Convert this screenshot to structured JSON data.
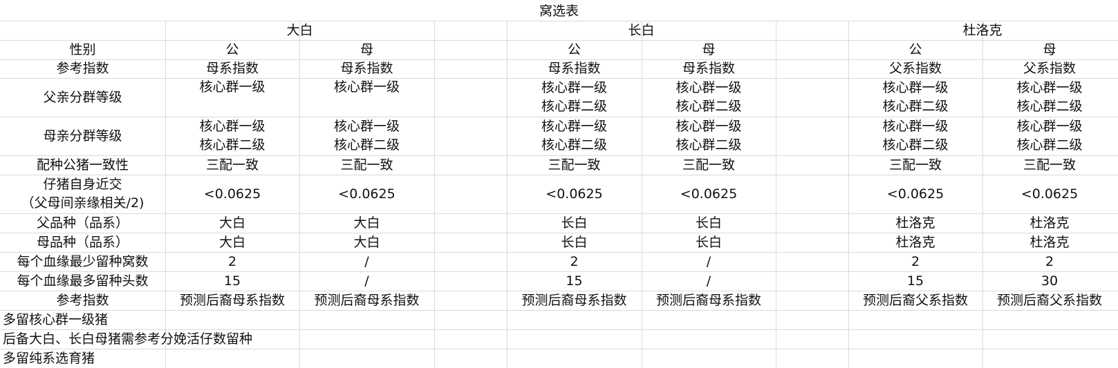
{
  "sheet": {
    "title": "窝选表",
    "breeds": [
      "大白",
      "长白",
      "杜洛克"
    ],
    "row_labels": {
      "sex": "性别",
      "ref_index": "参考指数",
      "father_grade": "父亲分群等级",
      "mother_grade": "母亲分群等级",
      "boar_consistency": "配种公猪一致性",
      "inbreeding_line1": "仔猪自身近交",
      "inbreeding_line2": "（父母间亲缘相关/2)",
      "father_breed": "父品种（品系）",
      "mother_breed": "母品种（品系）",
      "min_litters": "每个血缘最少留种窝数",
      "max_heads": "每个血缘最多留种头数",
      "ref_index2": "参考指数"
    },
    "columns": [
      {
        "sex": "公",
        "ref_index": "母系指数",
        "father_grade": [
          "核心群一级"
        ],
        "mother_grade": [
          "核心群一级",
          "核心群二级"
        ],
        "boar_consistency": "三配一致",
        "inbreeding": "<0.0625",
        "father_breed": "大白",
        "mother_breed": "大白",
        "min_litters": "2",
        "max_heads": "15",
        "ref_index2": "预测后裔母系指数"
      },
      {
        "sex": "母",
        "ref_index": "母系指数",
        "father_grade": [
          "核心群一级"
        ],
        "mother_grade": [
          "核心群一级",
          "核心群二级"
        ],
        "boar_consistency": "三配一致",
        "inbreeding": "<0.0625",
        "father_breed": "大白",
        "mother_breed": "大白",
        "min_litters": "/",
        "max_heads": "/",
        "ref_index2": "预测后裔母系指数"
      },
      {
        "sex": "公",
        "ref_index": "母系指数",
        "father_grade": [
          "核心群一级",
          "核心群二级"
        ],
        "mother_grade": [
          "核心群一级",
          "核心群二级"
        ],
        "boar_consistency": "三配一致",
        "inbreeding": "<0.0625",
        "father_breed": "长白",
        "mother_breed": "长白",
        "min_litters": "2",
        "max_heads": "15",
        "ref_index2": "预测后裔母系指数"
      },
      {
        "sex": "母",
        "ref_index": "母系指数",
        "father_grade": [
          "核心群一级",
          "核心群二级"
        ],
        "mother_grade": [
          "核心群一级",
          "核心群二级"
        ],
        "boar_consistency": "三配一致",
        "inbreeding": "<0.0625",
        "father_breed": "长白",
        "mother_breed": "长白",
        "min_litters": "/",
        "max_heads": "/",
        "ref_index2": "预测后裔母系指数"
      },
      {
        "sex": "公",
        "ref_index": "父系指数",
        "father_grade": [
          "核心群一级",
          "核心群二级"
        ],
        "mother_grade": [
          "核心群一级",
          "核心群二级"
        ],
        "boar_consistency": "三配一致",
        "inbreeding": "<0.0625",
        "father_breed": "杜洛克",
        "mother_breed": "杜洛克",
        "min_litters": "2",
        "max_heads": "15",
        "ref_index2": "预测后裔父系指数"
      },
      {
        "sex": "母",
        "ref_index": "父系指数",
        "father_grade": [
          "核心群一级",
          "核心群二级"
        ],
        "mother_grade": [
          "核心群一级",
          "核心群二级"
        ],
        "boar_consistency": "三配一致",
        "inbreeding": "<0.0625",
        "father_breed": "杜洛克",
        "mother_breed": "杜洛克",
        "min_litters": "2",
        "max_heads": "30",
        "ref_index2": "预测后裔父系指数"
      }
    ],
    "notes": [
      "多留核心群一级猪",
      "后备大白、长白母猪需参考分娩活仔数留种",
      "多留纯系选育猪"
    ],
    "colors": {
      "grid": "#d9d9d9",
      "text": "#111111",
      "background": "#ffffff"
    }
  }
}
